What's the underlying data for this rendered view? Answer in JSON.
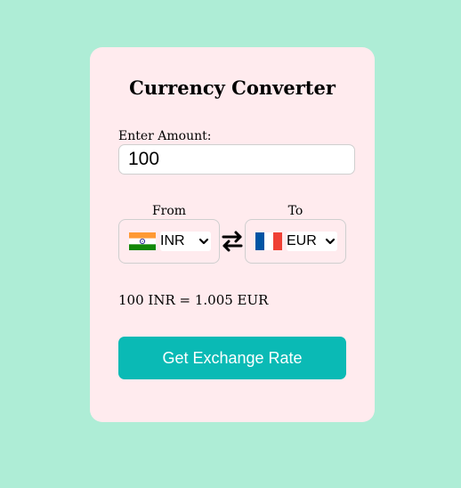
{
  "converter": {
    "title": "Currency Converter",
    "amount_label": "Enter Amount:",
    "amount_value": "100",
    "from_label": "From",
    "to_label": "To",
    "from_currency": "INR",
    "to_currency": "EUR",
    "from_flag_icon": "india-flag-icon",
    "to_flag_icon": "france-flag-icon",
    "swap_icon": "swap-arrows-icon",
    "result_text": "100 INR = 1.005 EUR",
    "button_label": "Get Exchange Rate"
  },
  "colors": {
    "page_background": "#aeedd6",
    "card_background": "#ffebee",
    "button_background": "#0abab5",
    "button_text": "#ffffff"
  }
}
